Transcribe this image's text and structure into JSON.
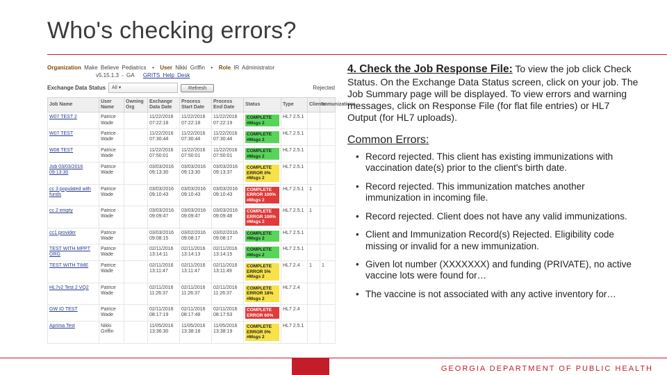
{
  "title": "Who's checking errors?",
  "screenshot": {
    "meta": {
      "org_label": "Organization",
      "org": "Make Believe Pediatrics",
      "user_label": "User",
      "user": "Nikki Griffin",
      "role_label": "Role",
      "role": "IR Administrator",
      "ver_prefix": "v5.15.1.3 - GA",
      "helpdesk": "GRITS Help Desk"
    },
    "filter": {
      "label": "Exchange Data Status",
      "value": "All",
      "refresh": "Refresh",
      "rejected": "Rejected"
    },
    "columns": [
      "Job Name",
      "User Name",
      "Owning Org",
      "Exchange Data Date",
      "Process Start Date",
      "Process End Date",
      "Status",
      "Type",
      "Clients",
      "Immunizations"
    ],
    "rows": [
      {
        "job": "W07 TEST 2",
        "user": "Patrice Wade",
        "d1": "11/22/2016 07:22:18",
        "d2": "11/22/2016 07:22:18",
        "d3": "11/22/2016 07:22:19",
        "status": "COMPLETE #Msgs 2",
        "cls": "green",
        "type": "HL7 2.5.1",
        "c": "",
        "r": ""
      },
      {
        "job": "W07 TEST",
        "user": "Patrice Wade",
        "d1": "11/22/2016 07:30:44",
        "d2": "11/22/2016 07:30:44",
        "d3": "11/22/2016 07:30:44",
        "status": "COMPLETE #Msgs 2",
        "cls": "green",
        "type": "HL7 2.5.1",
        "c": "",
        "r": ""
      },
      {
        "job": "W08 TEST",
        "user": "Patrice Wade",
        "d1": "11/22/2016 07:50:01",
        "d2": "11/22/2016 07:50:01",
        "d3": "11/22/2016 07:50:01",
        "status": "COMPLETE #Msgs 2",
        "cls": "green",
        "type": "HL7 2.5.1",
        "c": "",
        "r": ""
      },
      {
        "job": "Job 03/03/2016 09:13:30",
        "user": "Patrice Wade",
        "d1": "03/03/2016 09:13:30",
        "d2": "03/03/2016 09:13:30",
        "d3": "03/03/2016 09:13:37",
        "status": "COMPLETE ERROR 0% #Msgs 2",
        "cls": "yellow",
        "type": "HL7 2.5.1",
        "c": "",
        "r": ""
      },
      {
        "job": "cc 3 populated with funds",
        "user": "Patrice Wade",
        "d1": "03/03/2016 09:10:43",
        "d2": "03/03/2016 09:10:43",
        "d3": "03/03/2016 09:10:43",
        "status": "COMPLETE ERROR 100% #Msgs 2",
        "cls": "red",
        "type": "HL7 2.5.1",
        "c": "1",
        "r": ""
      },
      {
        "job": "cc 2 empty",
        "user": "Patrice Wade",
        "d1": "03/03/2016 09:09:47",
        "d2": "03/03/2016 09:09:47",
        "d3": "03/03/2016 09:09:48",
        "status": "COMPLETE ERROR 100% #Msgs 2",
        "cls": "red",
        "type": "HL7 2.5.1",
        "c": "1",
        "r": ""
      },
      {
        "job": "cc1 provider",
        "user": "Patrice Wade",
        "d1": "03/03/2016 09:08:15",
        "d2": "03/02/2016 09:08:17",
        "d3": "03/02/2016 09:08:17",
        "status": "COMPLETE #Msgs 2",
        "cls": "green",
        "type": "HL7 2.5.1",
        "c": "",
        "r": ""
      },
      {
        "job": "TEST WITH MPPT ORG",
        "user": "Patrice Wade",
        "d1": "02/11/2016 13:14:11",
        "d2": "02/11/2016 13:14:13",
        "d3": "02/11/2016 13:14:15",
        "status": "COMPLETE #Msgs 2",
        "cls": "green",
        "type": "HL7 2.5.1",
        "c": "",
        "r": ""
      },
      {
        "job": "TEST WITH TIME",
        "user": "Patrice Wade",
        "d1": "02/11/2016 13:11:47",
        "d2": "02/11/2016 13:11:47",
        "d3": "02/11/2016 13:11:49",
        "status": "COMPLETE ERROR 5% #Msgs 2",
        "cls": "yellow",
        "type": "HL7 2.4",
        "c": "1",
        "r": "1"
      },
      {
        "job": "HL7v2 Test 2 VQ2",
        "user": "Patrice Wade",
        "d1": "02/11/2016 11:26:37",
        "d2": "02/11/2016 11:26:37",
        "d3": "02/11/2016 11:26:37",
        "status": "COMPLETE ERROR 18% #Msgs 2",
        "cls": "yellow",
        "type": "HL7 2.4",
        "c": "",
        "r": ""
      },
      {
        "job": "GW ID TEST",
        "user": "Patrice Wade",
        "d1": "02/11/2016 08:17:19",
        "d2": "02/11/2016 08:17:48",
        "d3": "02/11/2016 08:17:53",
        "status": "COMPLETE ERROR 60%",
        "cls": "red",
        "type": "HL7 2.4",
        "c": "",
        "r": ""
      },
      {
        "job": "Aprima Test",
        "user": "Nikki Griffin",
        "d1": "11/05/2016 13:36:30",
        "d2": "11/05/2016 13:38:18",
        "d3": "11/05/2016 13:38:19",
        "status": "COMPLETE ERROR 0% #Msgs 2",
        "cls": "yellow",
        "type": "HL7 2.5.1",
        "c": "",
        "r": ""
      }
    ]
  },
  "step": {
    "head": "4. Check the Job Response File:",
    "body": "To view the job click Check Status. On the Exchange Data Status screen, click on your job. The Job Summary page will be displayed. To view errors and warning messages, click on Response File (for flat file entries) or HL7 Output (for HL7 uploads)."
  },
  "errors_head": "Common Errors:",
  "errors": [
    "Record rejected. This client has existing immunizations with vaccination date(s) prior to the client's birth date.",
    "Record rejected. This immunization matches another immunization in incoming file.",
    "Record rejected.  Client does not have any valid immunizations.",
    "Client and Immunization Record(s) Rejected. Eligibility code missing or invalid for a new immunization.",
    "Given lot number (XXXXXXX) and funding (PRIVATE), no active vaccine lots were found for…",
    "The vaccine is not associated with any active inventory for…"
  ],
  "footer": "GEORGIA DEPARTMENT OF PUBLIC HEALTH"
}
